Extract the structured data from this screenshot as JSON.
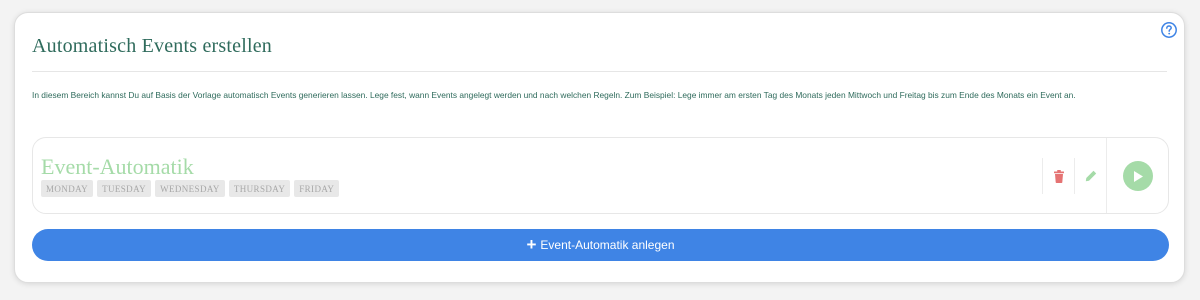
{
  "panel": {
    "title": "Automatisch Events erstellen",
    "help_icon": "question-circle-icon",
    "description": "In diesem Bereich kannst Du auf Basis der Vorlage automatisch Events generieren lassen. Lege fest, wann Events angelegt werden und nach welchen Regeln. Zum Beispiel: Lege immer am ersten Tag des Monats jeden Mittwoch und Freitag bis zum Ende des Monats ein Event an."
  },
  "automation": {
    "name": "Event-Automatik",
    "days": [
      "MONDAY",
      "TUESDAY",
      "WEDNESDAY",
      "THURSDAY",
      "FRIDAY"
    ],
    "actions": {
      "delete_icon": "trash-icon",
      "edit_icon": "pencil-icon",
      "run_icon": "play-icon"
    }
  },
  "add_button": {
    "icon": "+",
    "label": "Event-Automatik anlegen"
  },
  "colors": {
    "accent_blue": "#3f84e5",
    "title_green": "#2f6b5c",
    "light_green": "#a5dba8",
    "delete_red": "#e57373"
  }
}
